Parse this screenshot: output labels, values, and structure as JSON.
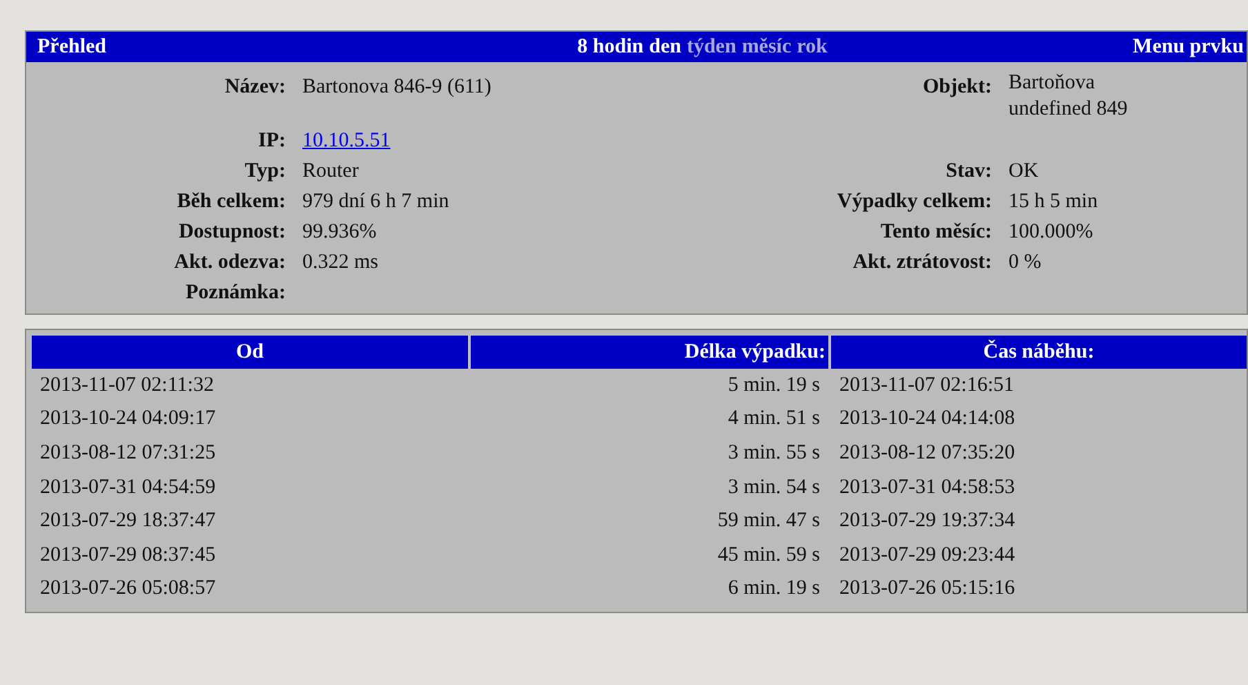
{
  "header": {
    "title": "Přehled",
    "periods": [
      {
        "label": "8 hodin",
        "disabled": false
      },
      {
        "label": "den",
        "disabled": false
      },
      {
        "label": "týden",
        "disabled": true
      },
      {
        "label": "měsíc",
        "disabled": true
      },
      {
        "label": "rok",
        "disabled": true
      }
    ],
    "menu": "Menu prvku"
  },
  "details": {
    "rows": [
      {
        "left": {
          "label": "Název:",
          "value": "Bartonova 846-9 (611)"
        },
        "right": {
          "label": "Objekt:",
          "value": "Bartoňova undefined 849"
        }
      },
      {
        "left": {
          "label": "IP:",
          "value": "10.10.5.51",
          "kind": "link"
        }
      },
      {
        "left": {
          "label": "Typ:",
          "value": "Router"
        },
        "right": {
          "label": "Stav:",
          "value": "OK"
        }
      },
      {
        "left": {
          "label": "Běh celkem:",
          "value": "979 dní 6 h 7 min"
        },
        "right": {
          "label": "Výpadky celkem:",
          "value": "15 h 5 min"
        }
      },
      {
        "left": {
          "label": "Dostupnost:",
          "value": "99.936%"
        },
        "right": {
          "label": "Tento měsíc:",
          "value": "100.000%"
        }
      },
      {
        "left": {
          "label": "Akt. odezva:",
          "value": "0.322 ms"
        },
        "right": {
          "label": "Akt. ztrátovost:",
          "value": "0 %"
        }
      },
      {
        "left": {
          "label": "Poznámka:"
        }
      }
    ]
  },
  "outages": {
    "columns": [
      "Od",
      "Délka výpadku:",
      "Čas náběhu:"
    ],
    "rows": [
      [
        "2013-11-07 02:11:32",
        "5 min. 19 s",
        "2013-11-07 02:16:51"
      ],
      [
        "2013-10-24 04:09:17",
        "4 min. 51 s",
        "2013-10-24 04:14:08"
      ],
      [
        "2013-08-12 07:31:25",
        "3 min. 55 s",
        "2013-08-12 07:35:20"
      ],
      [
        "2013-07-31 04:54:59",
        "3 min. 54 s",
        "2013-07-31 04:58:53"
      ],
      [
        "2013-07-29 18:37:47",
        "59 min. 47 s",
        "2013-07-29 19:37:34"
      ],
      [
        "2013-07-29 08:37:45",
        "45 min. 59 s",
        "2013-07-29 09:23:44"
      ],
      [
        "2013-07-26 05:08:57",
        "6 min. 19 s",
        "2013-07-26 05:15:16"
      ]
    ]
  }
}
